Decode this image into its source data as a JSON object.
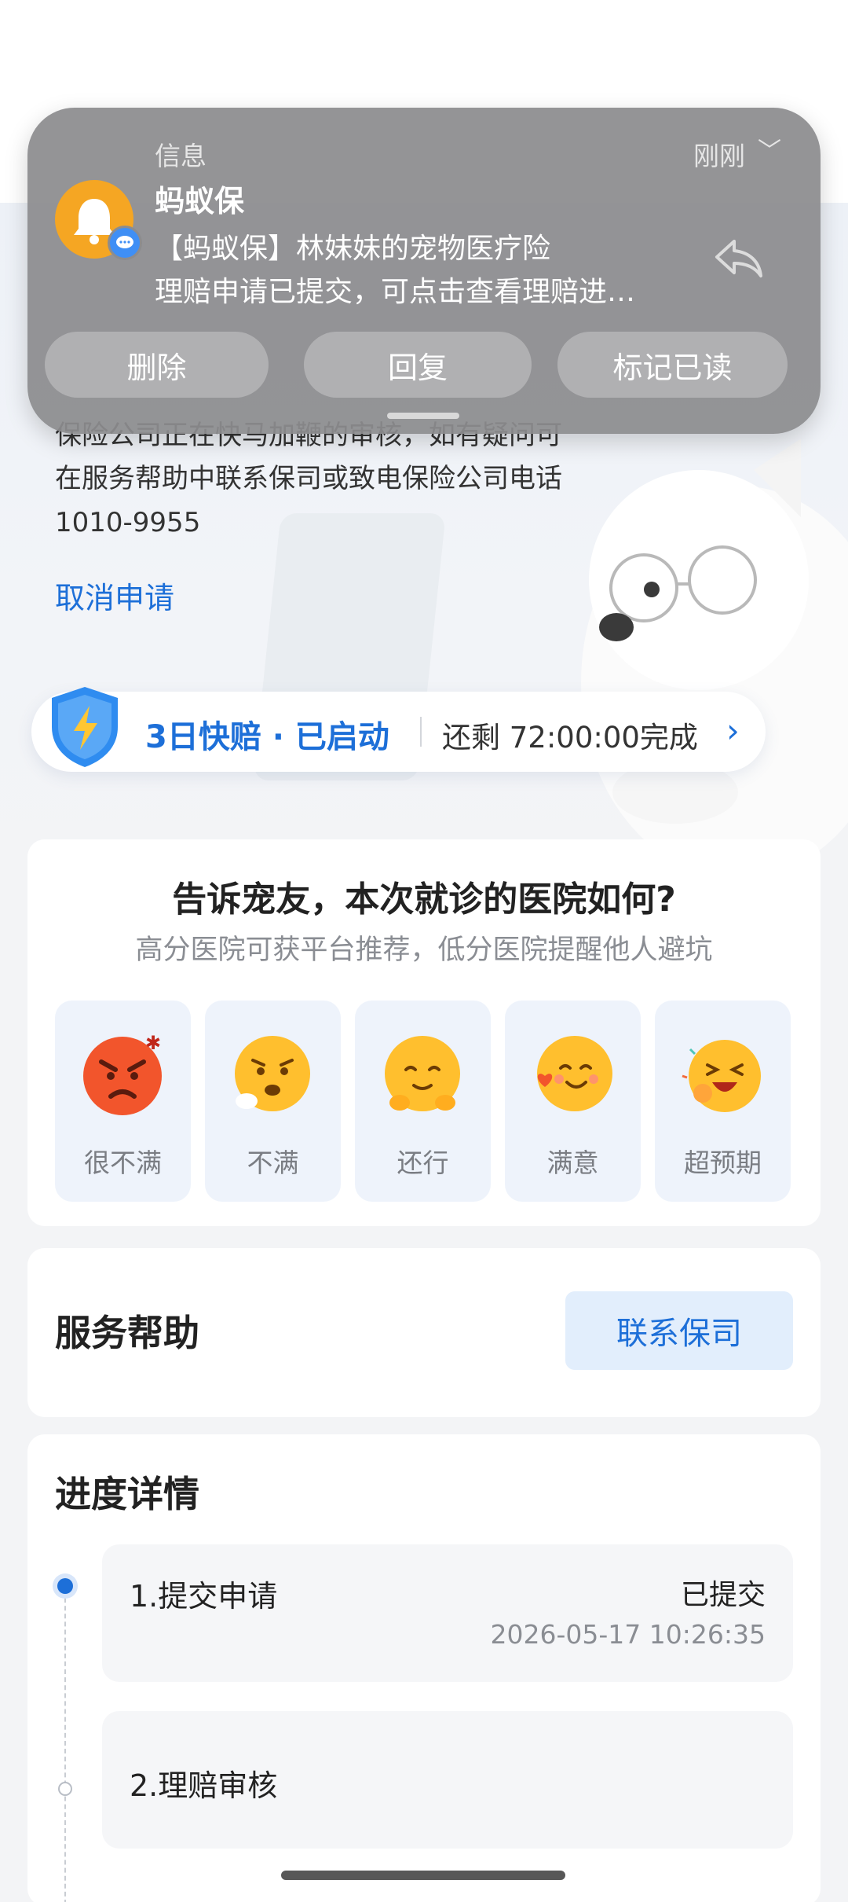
{
  "notification": {
    "app_name": "信息",
    "time": "刚刚",
    "sender": "蚂蚁保",
    "line1": "【蚂蚁保】林妹妹的宠物医疗险",
    "line2": "理赔申请已提交，可点击查看理赔进…",
    "actions": {
      "delete": "删除",
      "reply": "回复",
      "mark_read": "标记已读"
    }
  },
  "claim": {
    "body_lines": [
      "保险公司正在快马加鞭的审核，如有疑问可",
      "在服务帮助中联系保司或致电保险公司电话",
      "1010-9955"
    ],
    "cancel_label": "取消申请"
  },
  "fast_claim": {
    "title": "3日快赔 · 已启动",
    "remaining": "还剩 72:00:00完成"
  },
  "rating": {
    "title": "告诉宠友，本次就诊的医院如何?",
    "subtitle": "高分医院可获平台推荐，低分医院提醒他人避坑",
    "options": [
      {
        "label": "很不满",
        "icon": "angry-face-icon"
      },
      {
        "label": "不满",
        "icon": "worried-face-icon"
      },
      {
        "label": "还行",
        "icon": "neutral-face-icon"
      },
      {
        "label": "满意",
        "icon": "happy-heart-face-icon"
      },
      {
        "label": "超预期",
        "icon": "ecstatic-face-icon"
      }
    ]
  },
  "service_help": {
    "title": "服务帮助",
    "contact_label": "联系保司"
  },
  "progress": {
    "title": "进度详情",
    "steps": [
      {
        "name": "1.提交申请",
        "status": "已提交",
        "time": "2026-05-17 10:26:35"
      },
      {
        "name": "2.理赔审核"
      }
    ]
  },
  "colors": {
    "accent": "#1d6fd8",
    "background": "#f3f4f6",
    "notification": "#8c8c8e"
  }
}
